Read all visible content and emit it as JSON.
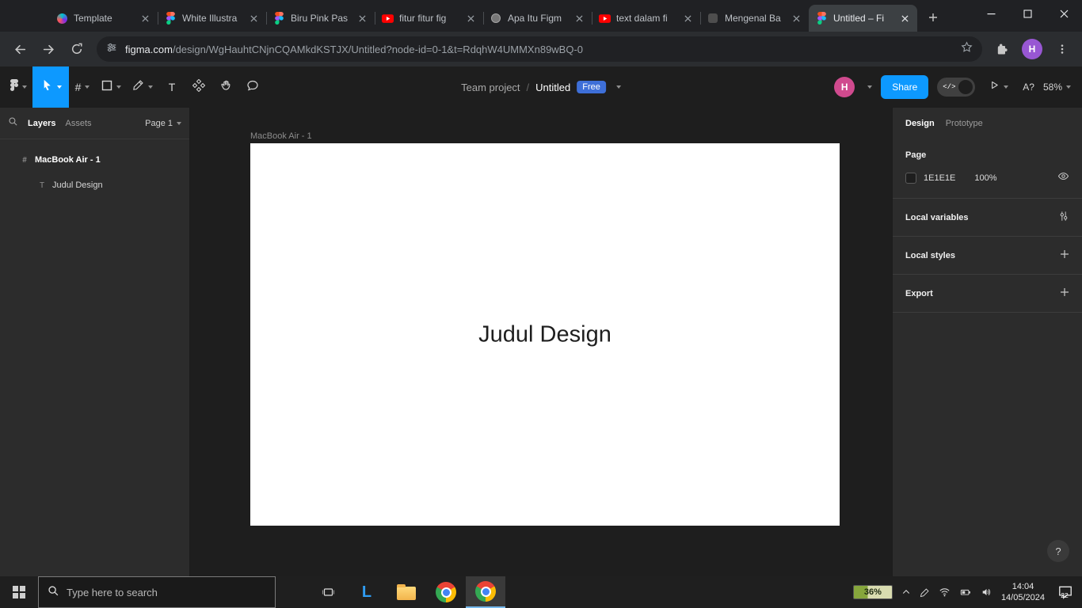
{
  "colors": {
    "figma_accent": "#0d99ff",
    "canvas_background": "#1e1e1e",
    "taskbar_active_underline": "#76b9ed"
  },
  "browser": {
    "tabs": [
      {
        "title": "Template"
      },
      {
        "title": "White Illustra"
      },
      {
        "title": "Biru Pink Pas"
      },
      {
        "title": "fitur fitur fig"
      },
      {
        "title": "Apa Itu Figm"
      },
      {
        "title": "text dalam fi"
      },
      {
        "title": "Mengenal Ba"
      },
      {
        "title": "Untitled – Fi"
      }
    ],
    "url_domain": "figma.com",
    "url_path": "/design/WgHauhtCNjnCQAMkdKSTJX/Untitled?node-id=0-1&t=RdqhW4UMMXn89wBQ-0",
    "profile_initial": "H"
  },
  "figma": {
    "toolbar": {
      "frame_tool_glyph": "#",
      "text_tool_glyph": "T",
      "dev_mode_glyph": "</>",
      "missing_fonts_label": "A?",
      "zoom": "58%",
      "share_label": "Share",
      "avatar_initial": "H"
    },
    "breadcrumb": {
      "project": "Team project",
      "separator": "/",
      "file": "Untitled",
      "badge": "Free"
    },
    "left_panel": {
      "tab_layers": "Layers",
      "tab_assets": "Assets",
      "page_selector": "Page 1",
      "layers": [
        {
          "icon": "#",
          "name": "MacBook Air - 1"
        },
        {
          "icon": "T",
          "name": "Judul Design"
        }
      ]
    },
    "canvas": {
      "frame_label": "MacBook Air - 1",
      "frame_text": "Judul Design"
    },
    "right_panel": {
      "tab_design": "Design",
      "tab_prototype": "Prototype",
      "page_heading": "Page",
      "page_color_hex": "1E1E1E",
      "page_color_opacity": "100%",
      "section_local_variables": "Local variables",
      "section_local_styles": "Local styles",
      "section_export": "Export"
    },
    "help_label": "?"
  },
  "taskbar": {
    "search_placeholder": "Type here to search",
    "app_letter": "L",
    "battery_percent": "36%",
    "time": "14:04",
    "date": "14/05/2024",
    "notification_count": "22"
  }
}
